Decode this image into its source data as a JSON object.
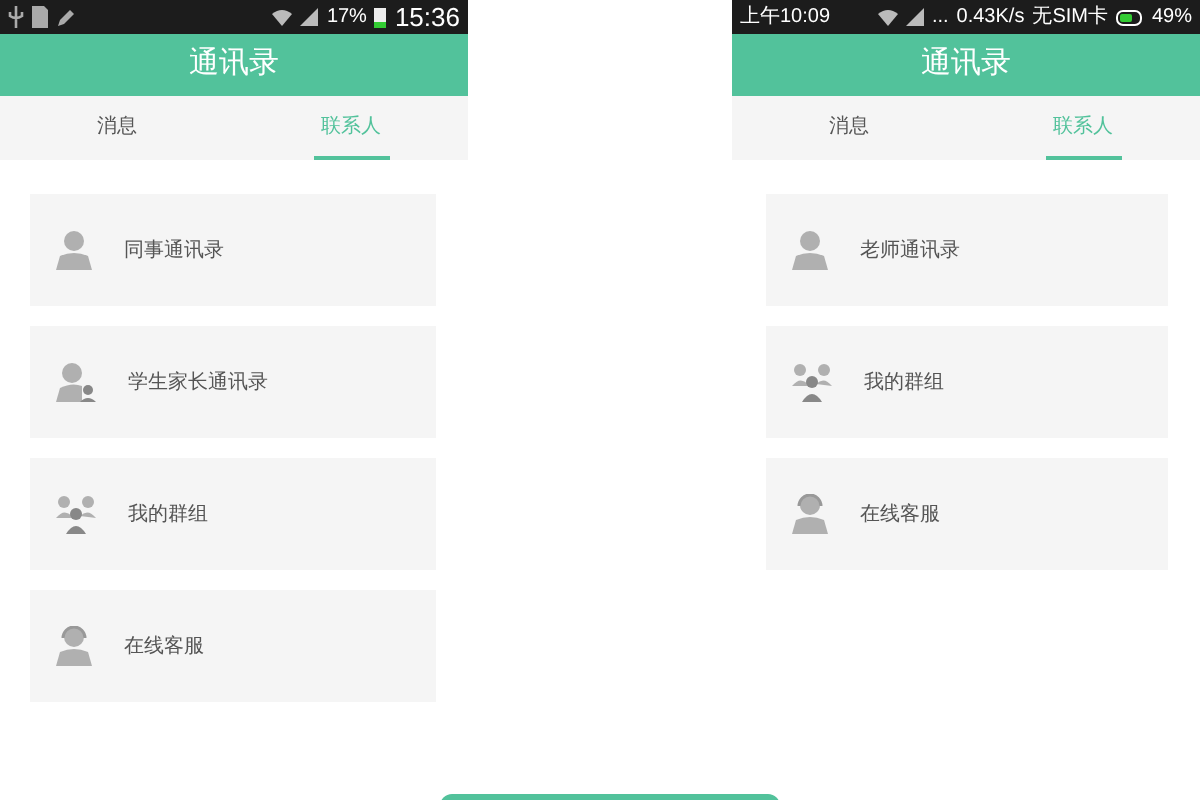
{
  "phones": [
    {
      "status_bar": {
        "kind": "icons",
        "right_texts": [
          "17%",
          "15:36"
        ]
      },
      "title": "通讯录",
      "tabs": [
        {
          "label": "消息",
          "selected": false
        },
        {
          "label": "联系人",
          "selected": true
        }
      ],
      "items": [
        {
          "label": "同事通讯录",
          "kind": "person"
        },
        {
          "label": "学生家长通讯录",
          "kind": "parent"
        },
        {
          "label": "我的群组",
          "kind": "group"
        },
        {
          "label": "在线客服",
          "kind": "service"
        }
      ]
    },
    {
      "status_bar": {
        "left_texts": [
          "上午10:09"
        ],
        "right_texts": [
          "...",
          "0.43K/s",
          "无SIM卡",
          "49%"
        ],
        "kind": "clock"
      },
      "title": "通讯录",
      "tabs": [
        {
          "label": "消息",
          "selected": false
        },
        {
          "label": "联系人",
          "selected": true
        }
      ],
      "items": [
        {
          "label": "老师通讯录",
          "kind": "person"
        },
        {
          "label": "我的群组",
          "kind": "group"
        },
        {
          "label": "在线客服",
          "kind": "service"
        }
      ]
    }
  ]
}
